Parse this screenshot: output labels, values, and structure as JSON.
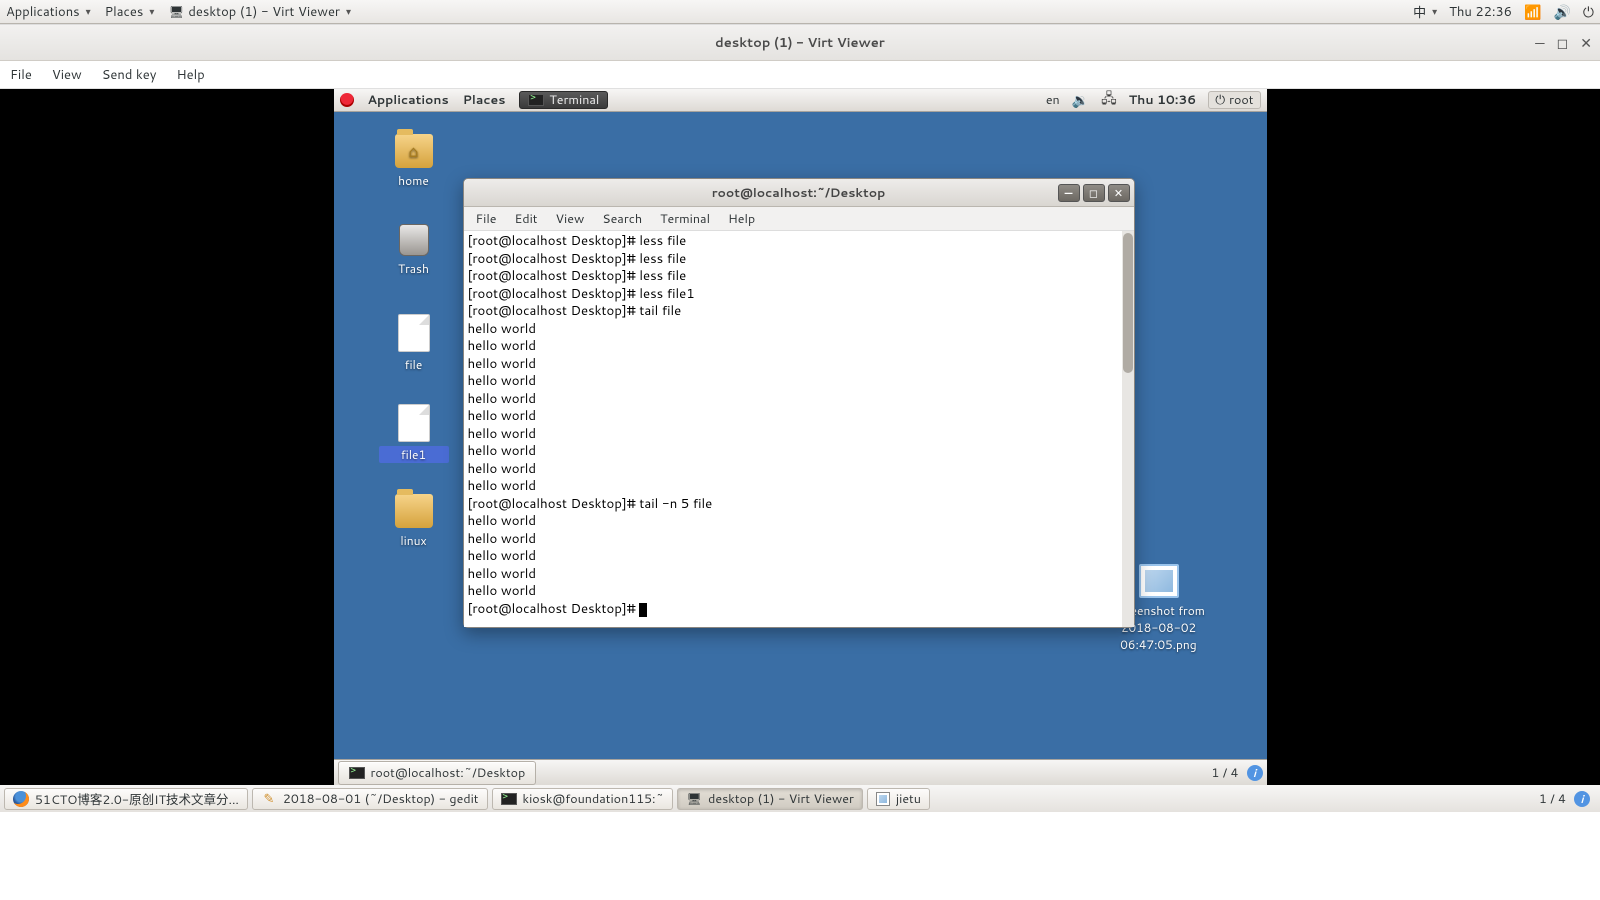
{
  "host_top": {
    "applications": "Applications",
    "places": "Places",
    "active_task": "desktop (1) - Virt Viewer",
    "ime": "中",
    "clock": "Thu 22:36"
  },
  "virt": {
    "title": "desktop (1) - Virt Viewer",
    "menu": {
      "file": "File",
      "view": "View",
      "sendkey": "Send key",
      "help": "Help"
    }
  },
  "gnome_top": {
    "applications": "Applications",
    "places": "Places",
    "terminal_task": "Terminal",
    "lang": "en",
    "clock": "Thu 10:36",
    "user": "root"
  },
  "desktop_icons": {
    "home": "home",
    "trash": "Trash",
    "file": "file",
    "file1": "file1",
    "linux": "linux",
    "screenshot": "Screenshot from 2018-08-02 06:47:05.png"
  },
  "terminal": {
    "title": "root@localhost:~/Desktop",
    "menu": {
      "file": "File",
      "edit": "Edit",
      "view": "View",
      "search": "Search",
      "terminal": "Terminal",
      "help": "Help"
    },
    "content": "[root@localhost Desktop]# less file\n[root@localhost Desktop]# less file\n[root@localhost Desktop]# less file\n[root@localhost Desktop]# less file1\n[root@localhost Desktop]# tail file\nhello world\nhello world\nhello world\nhello world\nhello world\nhello world\nhello world\nhello world\nhello world\nhello world\n[root@localhost Desktop]# tail -n 5 file\nhello world\nhello world\nhello world\nhello world\nhello world\n[root@localhost Desktop]# "
  },
  "gnome_bottom": {
    "task": "root@localhost:~/Desktop",
    "workspace": "1 / 4"
  },
  "host_bottom": {
    "tasks": {
      "t0": "51CTO博客2.0-原创IT技术文章分...",
      "t1": "2018-08-01 (~/Desktop) - gedit",
      "t2": "kiosk@foundation115:~",
      "t3": "desktop (1) - Virt Viewer",
      "t4": "jietu"
    },
    "workspace": "1 / 4"
  }
}
